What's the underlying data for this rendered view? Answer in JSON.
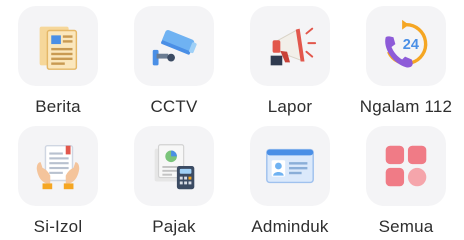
{
  "menu": {
    "items": [
      {
        "label": "Berita",
        "icon": "newspaper-icon"
      },
      {
        "label": "CCTV",
        "icon": "cctv-camera-icon"
      },
      {
        "label": "Lapor",
        "icon": "megaphone-icon"
      },
      {
        "label": "Ngalam 112",
        "icon": "phone-24-icon"
      },
      {
        "label": "Si-Izol",
        "icon": "document-hands-icon"
      },
      {
        "label": "Pajak",
        "icon": "tax-calculator-icon"
      },
      {
        "label": "Adminduk",
        "icon": "id-card-icon"
      },
      {
        "label": "Semua",
        "icon": "all-apps-grid-icon"
      }
    ],
    "colors": {
      "tile_bg": "#f4f4f6",
      "label": "#2e2e2e",
      "accent_blue": "#4a8fe6",
      "accent_orange": "#f5a623",
      "accent_red": "#e2574c",
      "accent_purple": "#8d5bd8",
      "accent_pink": "#f07b86"
    },
    "badge_text": "24"
  }
}
